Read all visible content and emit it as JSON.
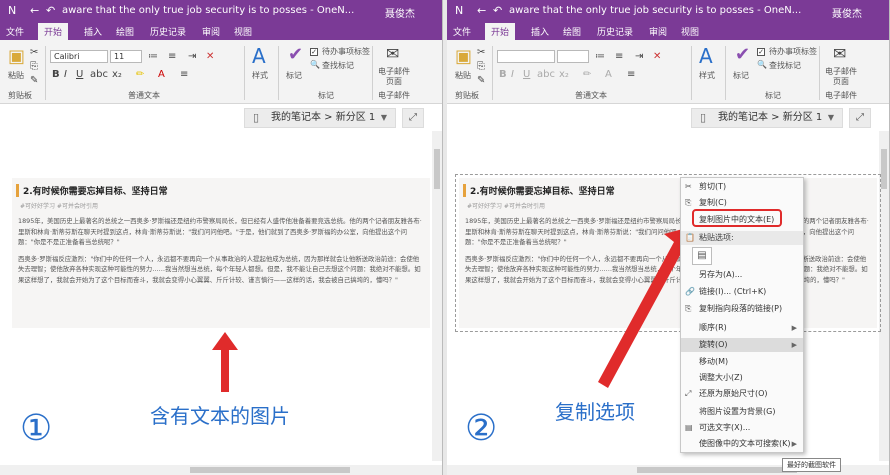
{
  "window": {
    "title": "aware that the only true job security is to posses - OneN...",
    "user": "聂俊杰"
  },
  "tabs": [
    "文件",
    "开始",
    "插入",
    "绘图",
    "历史记录",
    "审阅",
    "视图"
  ],
  "ribbon": {
    "paste_label": "粘贴",
    "clipboard_label": "剪贴板",
    "font_name": "Calibri",
    "font_size": "11",
    "text_group_label": "普通文本",
    "styles_label": "样式",
    "tags_label": "标记",
    "todo_label": "待办事项标签",
    "find_tags_label": "查找标记",
    "tags_group_label": "标记",
    "email_label_1": "电子邮件",
    "email_label_2": "页面",
    "email_group_label": "电子邮件"
  },
  "nav": {
    "breadcrumb": "我的笔记本 > 新分区 1"
  },
  "article": {
    "title": "2.有时候你需要忘掉目标、坚持日常",
    "tags": "#可好好学习 #可并会时引用",
    "para1": "1895年，美国历史上最著名的总统之一西奥多·罗斯福还是纽约市警察局局长，但已经有人盛传他准备着要竞选总统。他的两个记者朋友雅各布·里斯和林肯·斯蒂芬斯在聊天时提到这点，林肯·斯蒂芬斯说：\"我们问问他吧。\"于是，他们就到了西奥多·罗斯福的办公室，向他提出这个问题：\"你是不是正准备着当总统呢？\"",
    "para2": "西奥多·罗斯福反应激烈：\"你们中的任何一个人，永远都不要再向一个从事政治的人提起他成为总统，因为那样就会让他断送政治前途：会使他失去理智；使他放弃各种实现这种可能性的努力……我当然想当总统，每个年轻人都想。但是，我不能让自己去想这个问题：我绝对不能想。如果这样想了，我就会开始为了这个目标而奋斗，我就会变得小心翼翼、斤斤计较、谨言慎行——这样的话，我会被自己搞垮的，懂吗？\""
  },
  "captions": {
    "left_num": "①",
    "left_text": "含有文本的图片",
    "right_num": "②",
    "right_text": "复制选项"
  },
  "context_menu": {
    "items": [
      {
        "label": "剪切(T)",
        "icon": "✂"
      },
      {
        "label": "复制(C)",
        "icon": "⎘"
      },
      {
        "label": "复制图片中的文本(E)",
        "icon": ""
      },
      {
        "label": "粘贴选项:",
        "icon": "📋"
      },
      {
        "label": "",
        "icon": ""
      },
      {
        "label": "另存为(A)...",
        "icon": ""
      },
      {
        "label": "链接(I)...  (Ctrl+K)",
        "icon": "🔗"
      },
      {
        "label": "复制指向段落的链接(P)",
        "icon": "⎘"
      },
      {
        "label": "顺序(R)",
        "icon": ""
      },
      {
        "label": "旋转(O)",
        "icon": ""
      },
      {
        "label": "移动(M)",
        "icon": ""
      },
      {
        "label": "调整大小(Z)",
        "icon": ""
      },
      {
        "label": "还原为原始尺寸(O)",
        "icon": "⤢"
      },
      {
        "label": "将图片设置为背景(G)",
        "icon": ""
      },
      {
        "label": "可选文字(X)...",
        "icon": "▤"
      },
      {
        "label": "使图像中的文本可搜索(K)",
        "icon": ""
      }
    ]
  },
  "tooltip": "最好的截图软件",
  "colors": {
    "title_bar": "#7b3a96",
    "accent": "#2a6fc9",
    "highlight_red": "#e02b2b"
  }
}
